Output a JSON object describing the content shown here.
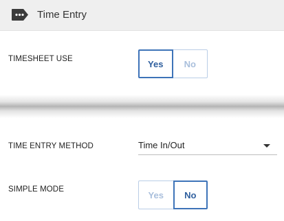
{
  "header": {
    "icon": "tag-ellipsis-icon",
    "title": "Time Entry"
  },
  "timesheet_use": {
    "label": "TIMESHEET USE",
    "yes": "Yes",
    "no": "No",
    "selected": "Yes"
  },
  "time_entry_method": {
    "label": "TIME ENTRY METHOD",
    "value": "Time In/Out",
    "icon": "dropdown-arrow-icon"
  },
  "simple_mode": {
    "label": "SIMPLE MODE",
    "yes": "Yes",
    "no": "No",
    "selected": "No"
  },
  "colors": {
    "accent": "#3d73b8",
    "inactive": "#a9bfdc",
    "header_bg": "#efefef"
  }
}
